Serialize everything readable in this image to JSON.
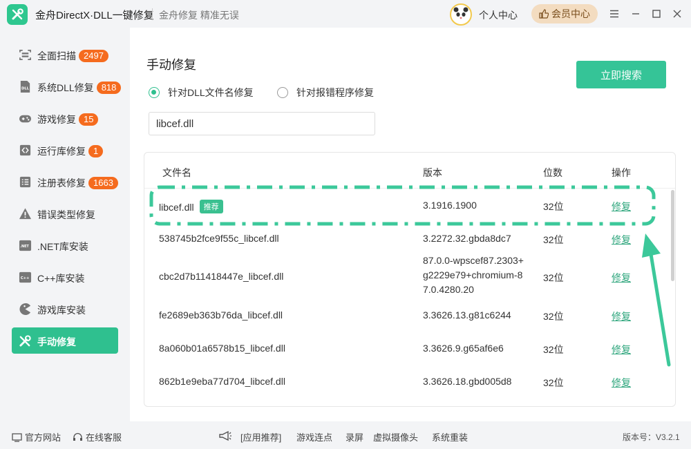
{
  "app": {
    "title": "金舟DirectX·DLL一键修复",
    "subtitle": "金舟修复 精准无误",
    "user_center": "个人中心",
    "member_center": "会员中心",
    "colors": {
      "accent": "#2fc08f",
      "badge": "#f56b1e",
      "member_bg": "#f3dcc0"
    }
  },
  "sidebar": {
    "items": [
      {
        "label": "全面扫描",
        "badge": "2497",
        "icon": "scan-icon"
      },
      {
        "label": "系统DLL修复",
        "badge": "818",
        "icon": "dll-icon"
      },
      {
        "label": "游戏修复",
        "badge": "15",
        "icon": "gamepad-icon"
      },
      {
        "label": "运行库修复",
        "badge": "1",
        "icon": "runtime-icon"
      },
      {
        "label": "注册表修复",
        "badge": "1663",
        "icon": "registry-icon"
      },
      {
        "label": "错误类型修复",
        "badge": "",
        "icon": "warning-icon"
      },
      {
        "label": ".NET库安装",
        "badge": "",
        "icon": "dotnet-icon"
      },
      {
        "label": "C++库安装",
        "badge": "",
        "icon": "cpp-icon"
      },
      {
        "label": "游戏库安装",
        "badge": "",
        "icon": "pacman-icon"
      },
      {
        "label": "手动修复",
        "badge": "",
        "icon": "tools-icon",
        "active": true
      }
    ]
  },
  "main": {
    "title": "手动修复",
    "search_button": "立即搜索",
    "radio_dll": "针对DLL文件名修复",
    "radio_error": "针对报错程序修复",
    "input_value": "libcef.dll",
    "table": {
      "headers": [
        "文件名",
        "版本",
        "位数",
        "操作"
      ],
      "recommend_label": "推荐",
      "rows": [
        {
          "name": "libcef.dll",
          "version": "3.1916.1900",
          "bits": "32位",
          "action": "修复"
        },
        {
          "name": "538745b2fce9f55c_libcef.dll",
          "version": "3.2272.32.gbda8dc7",
          "bits": "32位",
          "action": "修复"
        },
        {
          "name": "cbc2d7b11418447e_libcef.dll",
          "version_lines": [
            "87.0.0-wpscef87.2303+",
            "g2229e79+chromium-8",
            "7.0.4280.20"
          ],
          "bits": "32位",
          "action": "修复"
        },
        {
          "name": "fe2689eb363b76da_libcef.dll",
          "version": "3.3626.13.g81c6244",
          "bits": "32位",
          "action": "修复"
        },
        {
          "name": "8a060b01a6578b15_libcef.dll",
          "version": "3.3626.9.g65af6e6",
          "bits": "32位",
          "action": "修复"
        },
        {
          "name": "862b1e9eba77d704_libcef.dll",
          "version": "3.3626.18.gbd005d8",
          "bits": "32位",
          "action": "修复"
        }
      ]
    }
  },
  "footer": {
    "official_site": "官方网站",
    "online_service": "在线客服",
    "links": [
      "[应用推荐]",
      "游戏连点",
      "录屏",
      "虚拟摄像头",
      "系统重装"
    ],
    "version": "版本号：V3.2.1"
  }
}
